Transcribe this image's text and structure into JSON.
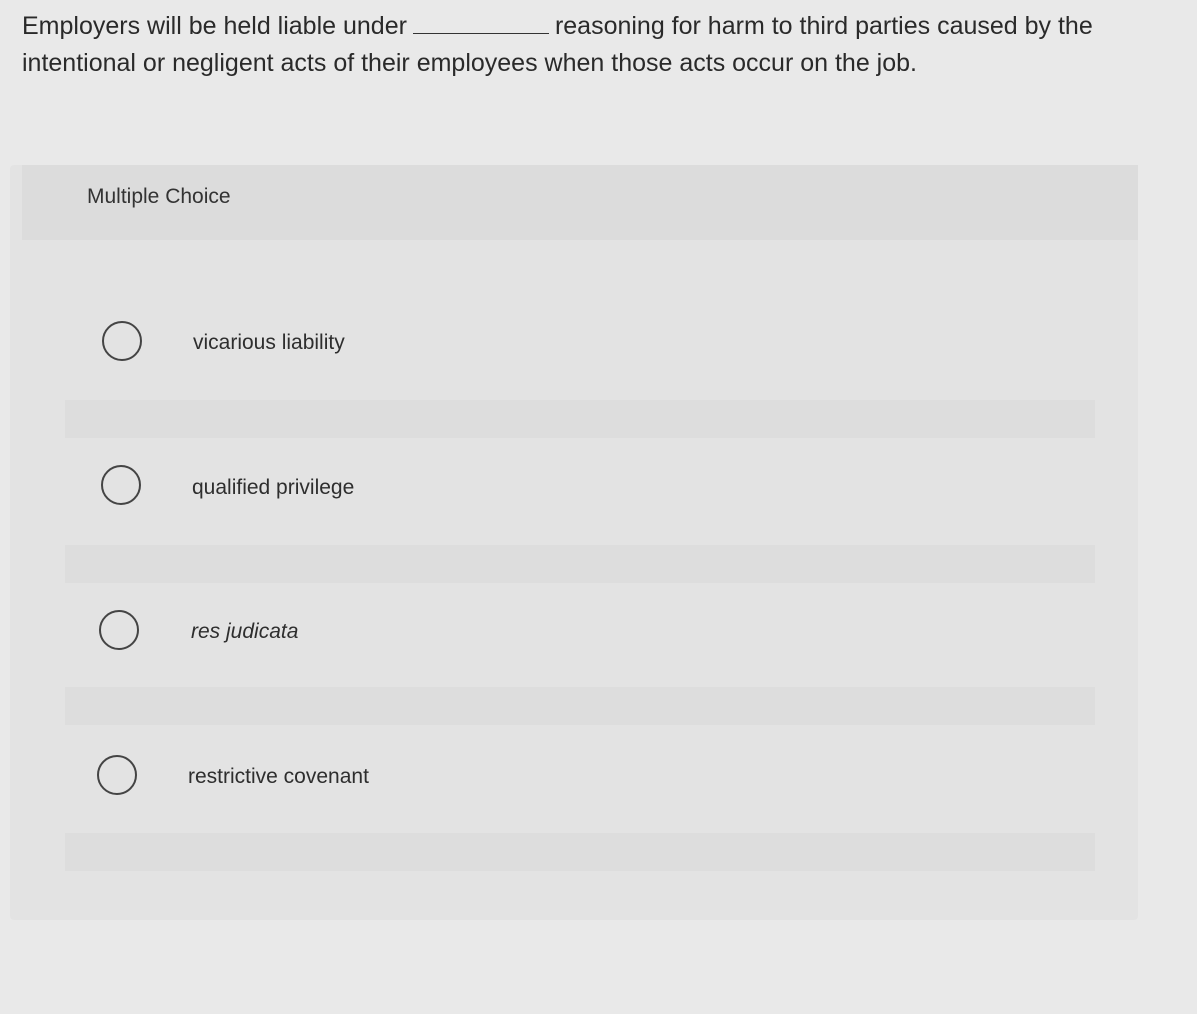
{
  "question": {
    "text_before": "Employers will be held liable under",
    "text_after": "reasoning for harm to third parties caused by the intentional or negligent acts of their employees when those acts occur on the job."
  },
  "multiple_choice": {
    "title": "Multiple Choice",
    "options": [
      {
        "label": "vicarious liability",
        "selected": false
      },
      {
        "label": "qualified privilege",
        "selected": false
      },
      {
        "label": "res judicata",
        "selected": false
      },
      {
        "label": "restrictive covenant",
        "selected": false
      }
    ]
  }
}
